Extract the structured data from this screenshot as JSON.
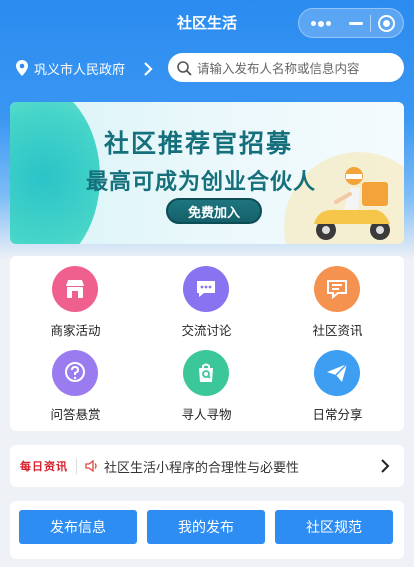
{
  "app": {
    "title": "社区生活"
  },
  "location": {
    "name": "巩义市人民政府"
  },
  "search": {
    "placeholder": "请输入发布人名称或信息内容"
  },
  "banner": {
    "title": "社区推荐官招募",
    "subtitle": "最高可成为创业合伙人",
    "button": "免费加入"
  },
  "categories": [
    {
      "label": "商家活动",
      "icon": "store-icon",
      "color": "#f0608e"
    },
    {
      "label": "交流讨论",
      "icon": "chat-bubble-icon",
      "color": "#8a73f0"
    },
    {
      "label": "社区资讯",
      "icon": "news-message-icon",
      "color": "#f5924f"
    },
    {
      "label": "问答悬赏",
      "icon": "question-bubble-icon",
      "color": "#9a7cf0"
    },
    {
      "label": "寻人寻物",
      "icon": "search-bag-icon",
      "color": "#3cc79a"
    },
    {
      "label": "日常分享",
      "icon": "paper-plane-icon",
      "color": "#3e9ef2"
    }
  ],
  "news": {
    "tag": "每日资讯",
    "text": "社区生活小程序的合理性与必要性"
  },
  "actions": {
    "publish": "发布信息",
    "my_posts": "我的发布",
    "rules": "社区规范"
  },
  "colors": {
    "primary": "#2e8df2",
    "header": "#2b8bf0",
    "banner_text": "#16707c",
    "news_tag": "#d81e2c"
  }
}
